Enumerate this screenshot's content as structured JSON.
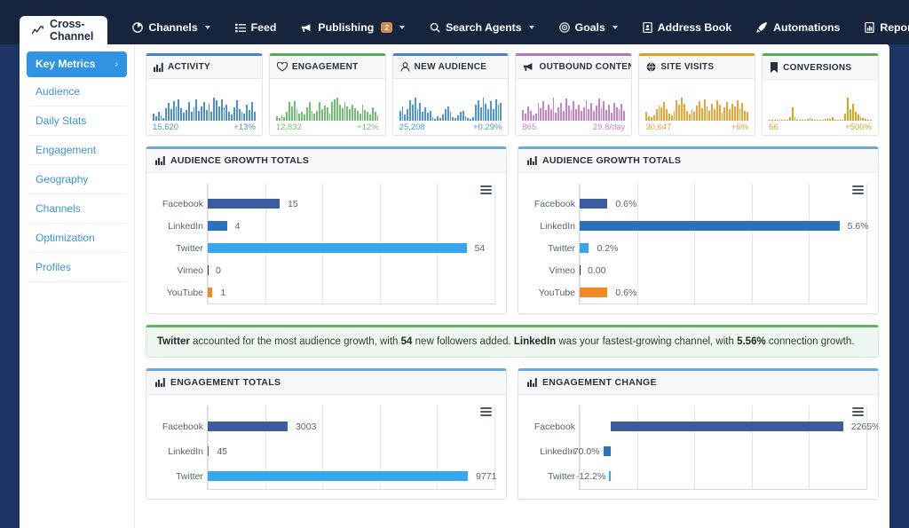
{
  "window": {
    "shell_color": "#1c3461",
    "navbar_color": "#16243e"
  },
  "topnav": {
    "active_tab": {
      "label": "Cross-Channel",
      "icon": "line-chart-icon"
    },
    "items": [
      {
        "label": "Channels",
        "icon": "pie-chart-icon",
        "caret": true,
        "badge": null
      },
      {
        "label": "Feed",
        "icon": "list-icon",
        "caret": false,
        "badge": null
      },
      {
        "label": "Publishing",
        "icon": "megaphone-icon",
        "caret": true,
        "badge": "2"
      },
      {
        "label": "Search Agents",
        "icon": "search-icon",
        "caret": true,
        "badge": null
      },
      {
        "label": "Goals",
        "icon": "target-icon",
        "caret": true,
        "badge": null
      },
      {
        "label": "Address Book",
        "icon": "address-book-icon",
        "caret": false,
        "badge": null
      },
      {
        "label": "Automations",
        "icon": "rocket-icon",
        "caret": false,
        "badge": null
      },
      {
        "label": "Reports",
        "icon": "report-icon",
        "caret": true,
        "badge": null
      }
    ]
  },
  "sidebar": {
    "items": [
      {
        "label": "Key Metrics",
        "active": true,
        "chevron": "›"
      },
      {
        "label": "Audience",
        "active": false
      },
      {
        "label": "Daily Stats",
        "active": false
      },
      {
        "label": "Engagement",
        "active": false
      },
      {
        "label": "Geography",
        "active": false
      },
      {
        "label": "Channels",
        "active": false
      },
      {
        "label": "Optimization",
        "active": false
      },
      {
        "label": "Profiles",
        "active": false
      }
    ]
  },
  "metric_cards": [
    {
      "title": "ACTIVITY",
      "icon": "bar-chart-icon",
      "accent": "#4a80c4",
      "spark_color": "#4e8fd0",
      "value": "15,620",
      "delta": "+13%",
      "spark": [
        22,
        14,
        28,
        18,
        9,
        40,
        58,
        38,
        64,
        46,
        70,
        40,
        26,
        34,
        60,
        30,
        44,
        70,
        32,
        46,
        62,
        36,
        56,
        30,
        76,
        66,
        48,
        70,
        44,
        54,
        30,
        20,
        44,
        68,
        38,
        30,
        24,
        52,
        36,
        60,
        30
      ]
    },
    {
      "title": "ENGAGEMENT",
      "icon": "heart-icon",
      "accent": "#5aa95f",
      "spark_color": "#6fbf73",
      "value": "12,832",
      "delta": "+12%",
      "spark": [
        14,
        8,
        20,
        12,
        30,
        64,
        50,
        68,
        40,
        26,
        30,
        22,
        46,
        66,
        34,
        24,
        34,
        64,
        40,
        52,
        46,
        26,
        66,
        74,
        80,
        56,
        44,
        66,
        50,
        40,
        56,
        44,
        34,
        26,
        54,
        38,
        30,
        22,
        46,
        30,
        20
      ]
    },
    {
      "title": "NEW AUDIENCE",
      "icon": "user-icon",
      "accent": "#4a80c4",
      "spark_color": "#4e94dc",
      "value": "25,208",
      "delta": "+0.29%",
      "spark": [
        30,
        44,
        20,
        34,
        62,
        48,
        70,
        36,
        54,
        28,
        40,
        24,
        30,
        10,
        6,
        14,
        8,
        20,
        34,
        44,
        26,
        10,
        8,
        16,
        26,
        30,
        14,
        8,
        6,
        12,
        48,
        62,
        40,
        70,
        52,
        36,
        60,
        34,
        66,
        48,
        54
      ]
    },
    {
      "title": "OUTBOUND CONTENT",
      "icon": "megaphone-icon",
      "accent": "#b07bb5",
      "spark_color": "#c97fc9",
      "value": "865",
      "delta": "29.8/day",
      "spark": [
        34,
        24,
        46,
        30,
        18,
        22,
        58,
        40,
        64,
        34,
        52,
        38,
        74,
        26,
        44,
        58,
        30,
        70,
        48,
        34,
        62,
        36,
        52,
        30,
        44,
        66,
        38,
        56,
        30,
        48,
        70,
        40,
        62,
        34,
        50,
        26,
        58,
        44,
        36,
        54,
        30
      ]
    },
    {
      "title": "SITE VISITS",
      "icon": "globe-icon",
      "accent": "#e0a21e",
      "spark_color": "#f0a22e",
      "value": "30,647",
      "delta": "+6%",
      "spark": [
        28,
        14,
        10,
        16,
        34,
        46,
        40,
        56,
        34,
        22,
        16,
        30,
        62,
        48,
        70,
        52,
        30,
        20,
        34,
        26,
        46,
        58,
        38,
        66,
        44,
        30,
        52,
        36,
        62,
        48,
        24,
        40,
        56,
        34,
        50,
        44,
        62,
        38,
        54,
        30,
        26
      ]
    },
    {
      "title": "CONVERSIONS",
      "icon": "bookmark-icon",
      "accent": "#5aa95f",
      "spark_color": "#d9a520",
      "value": "66",
      "delta": "+500%",
      "spark": [
        0,
        0,
        0,
        0,
        0,
        0,
        0,
        0,
        12,
        40,
        10,
        0,
        0,
        0,
        4,
        6,
        8,
        6,
        4,
        0,
        0,
        0,
        6,
        8,
        6,
        10,
        4,
        0,
        0,
        0,
        22,
        70,
        34,
        52,
        26,
        18,
        12,
        8,
        6,
        4,
        3
      ]
    }
  ],
  "panels": {
    "audience_growth_totals": {
      "title": "AUDIENCE GROWTH TOTALS",
      "icon": "bar-chart-icon",
      "menu_icon": "chart-menu-icon"
    },
    "audience_growth_pct": {
      "title": "AUDIENCE GROWTH TOTALS",
      "icon": "bar-chart-icon",
      "menu_icon": "chart-menu-icon"
    },
    "engagement_totals": {
      "title": "ENGAGEMENT TOTALS",
      "icon": "bar-chart-icon",
      "menu_icon": "chart-menu-icon"
    },
    "engagement_change": {
      "title": "ENGAGEMENT CHANGE",
      "icon": "bar-chart-icon",
      "menu_icon": "chart-menu-icon"
    }
  },
  "note": {
    "parts": [
      {
        "text": "Twitter",
        "bold": true
      },
      {
        "text": " accounted for the most audience growth, with ",
        "bold": false
      },
      {
        "text": "54",
        "bold": true
      },
      {
        "text": " new followers added. ",
        "bold": false
      },
      {
        "text": "LinkedIn",
        "bold": true
      },
      {
        "text": " was your fastest-growing channel, with ",
        "bold": false
      },
      {
        "text": "5.56%",
        "bold": true
      },
      {
        "text": " connection growth.",
        "bold": false
      }
    ]
  },
  "channel_colors": {
    "Facebook": "#3b5c9f",
    "LinkedIn": "#2a72bd",
    "Twitter": "#36a6ef",
    "Vimeo": "#2d3237",
    "YouTube": "#ef8b22"
  },
  "chart_data": [
    {
      "id": "audience_growth_totals",
      "type": "bar",
      "orientation": "horizontal",
      "title": "AUDIENCE GROWTH TOTALS",
      "categories": [
        "Facebook",
        "LinkedIn",
        "Twitter",
        "Vimeo",
        "YouTube"
      ],
      "values": [
        15,
        4,
        54,
        0,
        1
      ],
      "labels": [
        "15",
        "4",
        "54",
        "0",
        "1"
      ],
      "xlabel": "",
      "ylabel": "",
      "xlim": [
        0,
        60
      ],
      "grid": true,
      "gridlines": 6,
      "legend": "none"
    },
    {
      "id": "audience_growth_percent",
      "type": "bar",
      "orientation": "horizontal",
      "title": "AUDIENCE GROWTH TOTALS",
      "categories": [
        "Facebook",
        "LinkedIn",
        "Twitter",
        "Vimeo",
        "YouTube"
      ],
      "values": [
        0.6,
        5.6,
        0.2,
        0.0,
        0.6
      ],
      "labels": [
        "0.6%",
        "5.6%",
        "0.2%",
        "0.00",
        "0.6%"
      ],
      "xlabel": "",
      "ylabel": "",
      "xlim": [
        0,
        6.2
      ],
      "grid": true,
      "gridlines": 6,
      "legend": "none"
    },
    {
      "id": "engagement_totals",
      "type": "bar",
      "orientation": "horizontal",
      "title": "ENGAGEMENT TOTALS",
      "categories": [
        "Facebook",
        "LinkedIn",
        "Twitter"
      ],
      "values": [
        3003,
        45,
        9771
      ],
      "labels": [
        "3003",
        "45",
        "9771"
      ],
      "xlabel": "",
      "ylabel": "",
      "xlim": [
        0,
        10800
      ],
      "grid": true,
      "gridlines": 6,
      "legend": "none",
      "note": "panel clipped by viewport bottom; additional rows below fold"
    },
    {
      "id": "engagement_change",
      "type": "bar",
      "orientation": "horizontal",
      "title": "ENGAGEMENT CHANGE",
      "categories": [
        "Facebook",
        "LinkedIn",
        "Twitter"
      ],
      "values": [
        2265,
        -70.0,
        -12.2
      ],
      "labels": [
        "2265%",
        "-70.0%",
        "-12.2%"
      ],
      "xlabel": "",
      "ylabel": "",
      "xlim": [
        -300,
        2500
      ],
      "grid": true,
      "gridlines": 6,
      "legend": "none",
      "note": "panel clipped by viewport bottom; additional rows below fold"
    }
  ]
}
